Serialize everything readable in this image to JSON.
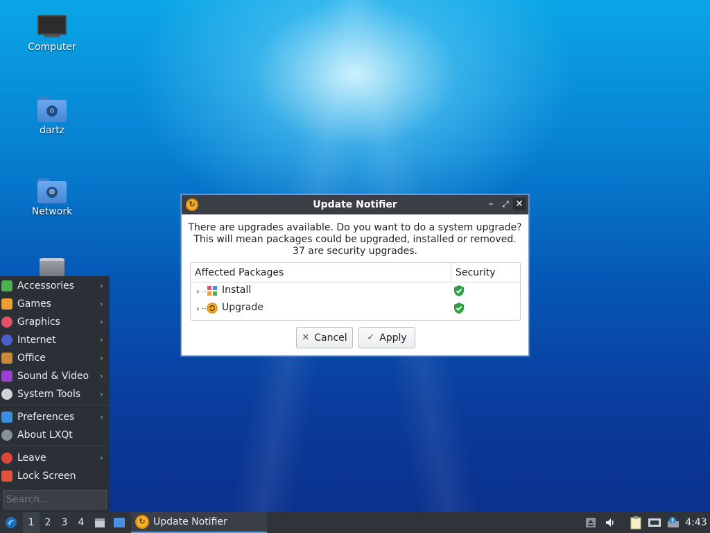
{
  "desktop": {
    "icons": [
      {
        "label": "Computer"
      },
      {
        "label": "dartz"
      },
      {
        "label": "Network"
      }
    ]
  },
  "start_menu": {
    "items": [
      {
        "label": "Accessories",
        "icon": "accessories-icon",
        "color": "#4caf50"
      },
      {
        "label": "Games",
        "icon": "games-icon",
        "color": "#f0a030"
      },
      {
        "label": "Graphics",
        "icon": "graphics-icon",
        "color": "#e2506a"
      },
      {
        "label": "Internet",
        "icon": "internet-icon",
        "color": "#4a5fd0"
      },
      {
        "label": "Office",
        "icon": "office-icon",
        "color": "#c9883a"
      },
      {
        "label": "Sound & Video",
        "icon": "sound-video-icon",
        "color": "#9b3fd0"
      },
      {
        "label": "System Tools",
        "icon": "system-tools-icon",
        "color": "#cfd4d9"
      },
      {
        "label": "Preferences",
        "icon": "preferences-icon",
        "color": "#3b8fe0"
      },
      {
        "label": "About LXQt",
        "icon": "about-icon",
        "color": "#8a9097"
      },
      {
        "label": "Leave",
        "icon": "leave-icon",
        "color": "#e0453a"
      },
      {
        "label": "Lock Screen",
        "icon": "lock-icon",
        "color": "#e0553a"
      }
    ],
    "search_placeholder": "Search..."
  },
  "dialog": {
    "title": "Update Notifier",
    "message_line1": "There are upgrades available. Do you want to do a system upgrade?",
    "message_line2": "This will mean packages could be upgraded, installed or removed.",
    "message_line3": "37 are security upgrades.",
    "columns": [
      "Affected Packages",
      "Security"
    ],
    "rows": [
      {
        "label": "Install",
        "icon": "install-icon"
      },
      {
        "label": "Upgrade",
        "icon": "upgrade-icon"
      }
    ],
    "cancel_label": "Cancel",
    "apply_label": "Apply"
  },
  "taskbar": {
    "workspaces": [
      "1",
      "2",
      "3",
      "4"
    ],
    "active_task": "Update Notifier",
    "clock": "4:43"
  },
  "colors": {
    "accent": "#5b9bd5",
    "shield_green": "#2ea043",
    "panel": "#2f343b"
  }
}
